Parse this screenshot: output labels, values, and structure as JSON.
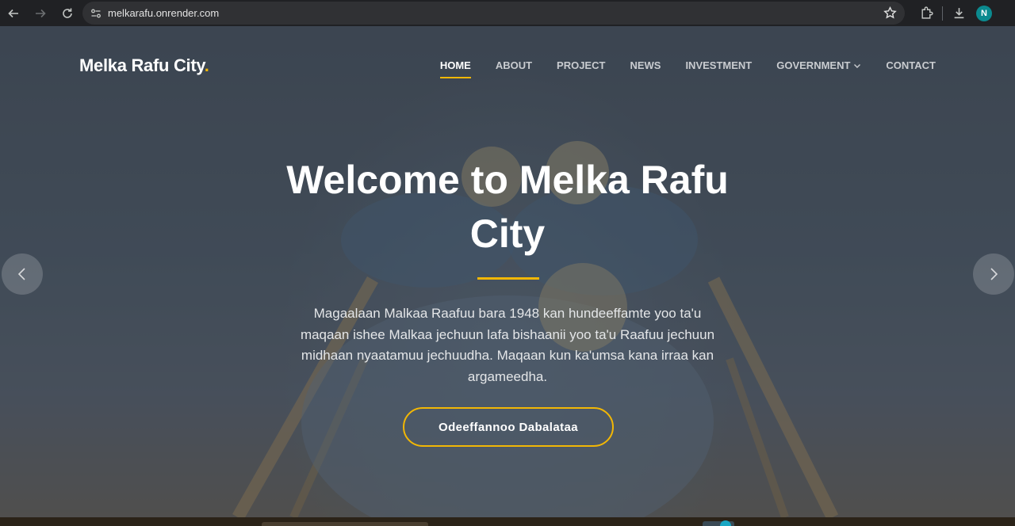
{
  "browser": {
    "url": "melkarafu.onrender.com",
    "profile_initial": "N"
  },
  "site": {
    "logo_text": "Melka Rafu City",
    "logo_dot": ".",
    "nav": [
      {
        "label": "HOME",
        "active": true
      },
      {
        "label": "ABOUT"
      },
      {
        "label": "PROJECT"
      },
      {
        "label": "NEWS"
      },
      {
        "label": "INVESTMENT"
      },
      {
        "label": "GOVERNMENT",
        "has_dropdown": true
      },
      {
        "label": "CONTACT"
      }
    ]
  },
  "hero": {
    "title": "Welcome to Melka Rafu City",
    "description": "Magaalaan Malkaa Raafuu bara 1948 kan hundeeffamte yoo ta'u maqaan ishee Malkaa jechuun lafa bishaanii yoo ta'u Raafuu jechuun midhaan nyaatamuu jechuudha. Maqaan kun ka'umsa kana irraa kan argameedha.",
    "cta_label": "Odeeffannoo Dabalataa"
  },
  "colors": {
    "accent": "#f2b705",
    "overlay": "#1c242e"
  },
  "icons": [
    "back-icon",
    "forward-icon",
    "reload-icon",
    "site-info-icon",
    "bookmark-star-icon",
    "extensions-icon",
    "download-icon",
    "chevron-down-icon",
    "chevron-left-icon",
    "chevron-right-icon"
  ]
}
